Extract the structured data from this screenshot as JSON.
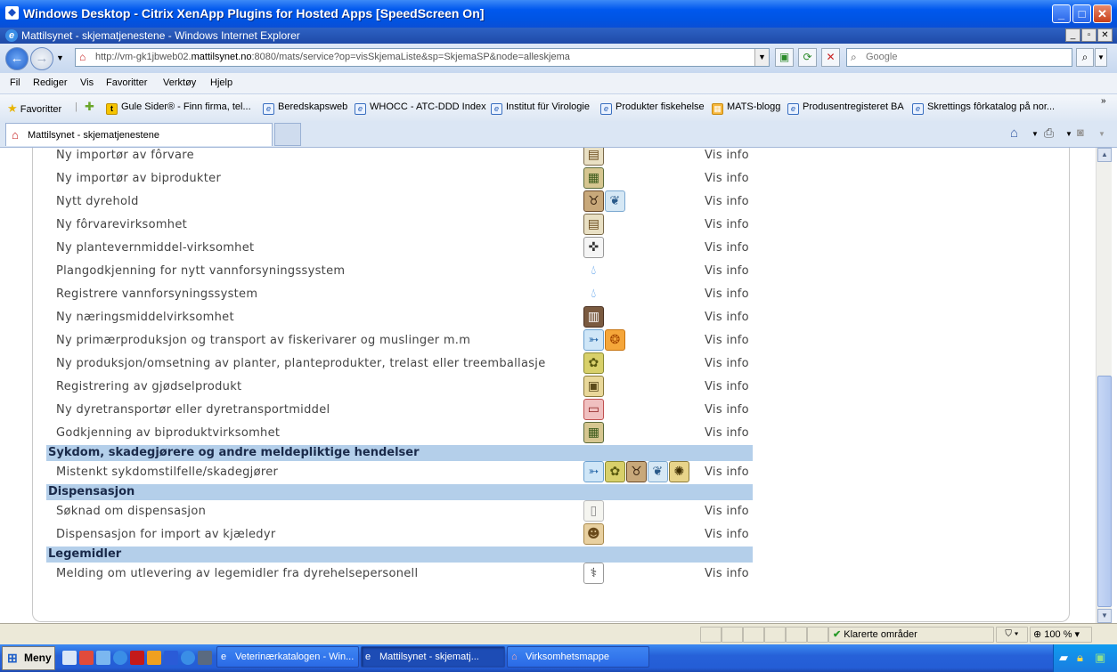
{
  "outer_window": {
    "title": "Windows Desktop - Citrix XenApp Plugins for Hosted Apps [SpeedScreen On]"
  },
  "ie_window": {
    "title": "Mattilsynet - skjematjenestene - Windows Internet Explorer"
  },
  "address": {
    "url_prefix": "http://vm-gk1jbweb02.",
    "url_host": "mattilsynet.no",
    "url_rest": ":8080/mats/service?op=visSkjemaListe&sp=SkjemaSP&node=alleskjema"
  },
  "search": {
    "placeholder": "Google"
  },
  "menu": [
    "Fil",
    "Rediger",
    "Vis",
    "Favoritter",
    "Verktøy",
    "Hjelp"
  ],
  "favorites": {
    "label": "Favoritter",
    "items": [
      "Gule Sider® - Finn firma, tel...",
      "Beredskapsweb",
      "WHOCC - ATC-DDD Index",
      "Institut für Virologie",
      "Produkter fiskehelse",
      "MATS-blogg",
      "Produsentregisteret BA",
      "Skrettings fôrkatalog på nor..."
    ]
  },
  "tabs": {
    "active": "Mattilsynet - skjematjenestene"
  },
  "content": {
    "info_label": "Vis info",
    "rows_a": [
      {
        "name": "Ny importør av fôrvare",
        "icons": [
          "feed-icon"
        ]
      },
      {
        "name": "Ny importør av biprodukter",
        "icons": [
          "byproduct-icon"
        ]
      },
      {
        "name": "Nytt dyrehold",
        "icons": [
          "cow-icon",
          "bird-icon"
        ]
      },
      {
        "name": "Ny fôrvarevirksomhet",
        "icons": [
          "feed-icon"
        ]
      },
      {
        "name": "Ny plantevernmiddel-virksomhet",
        "icons": [
          "sprayer-icon"
        ]
      },
      {
        "name": "Plangodkjenning for nytt vannforsyningssystem",
        "icons": [
          "water-drop-icon"
        ]
      },
      {
        "name": "Registrere vannforsyningssystem",
        "icons": [
          "water-drop-icon"
        ]
      },
      {
        "name": "Ny næringsmiddelvirksomhet",
        "icons": [
          "food-can-icon"
        ]
      },
      {
        "name": "Ny primærproduksjon og transport av fiskerivarer og muslinger m.m",
        "icons": [
          "fish-icon",
          "shell-icon"
        ]
      },
      {
        "name": "Ny produksjon/omsetning av planter, planteprodukter, trelast eller treemballasje",
        "icons": [
          "plant-icon"
        ]
      },
      {
        "name": "Registrering av gjødselprodukt",
        "icons": [
          "fertilizer-icon"
        ]
      },
      {
        "name": "Ny dyretransportør eller dyretransportmiddel",
        "icons": [
          "truck-icon"
        ]
      },
      {
        "name": "Godkjenning av biproduktvirksomhet",
        "icons": [
          "byproduct-icon"
        ]
      }
    ],
    "sections": [
      {
        "title": "Sykdom, skadegjørere og andre meldepliktige hendelser",
        "rows": [
          {
            "name": "Mistenkt sykdomstilfelle/skadegjører",
            "icons": [
              "fish-icon",
              "plant-icon",
              "cow-icon",
              "bird-icon",
              "bee-icon"
            ]
          }
        ]
      },
      {
        "title": "Dispensasjon",
        "rows": [
          {
            "name": "Søknad om dispensasjon",
            "icons": [
              "document-icon"
            ]
          },
          {
            "name": "Dispensasjon for import av kjæledyr",
            "icons": [
              "dog-icon"
            ]
          }
        ]
      },
      {
        "title": "Legemidler",
        "rows": [
          {
            "name": "Melding om utlevering av legemidler fra dyrehelsepersonell",
            "icons": [
              "syringe-icon"
            ]
          }
        ]
      }
    ]
  },
  "status": {
    "zone": "Klarerte områder",
    "zoom": "100 %"
  },
  "taskbar": {
    "start": "Meny",
    "tasks": [
      "Veterinærkatalogen - Win...",
      "Mattilsynet - skjematj...",
      "Virksomhetsmappe"
    ]
  },
  "colors": {
    "section_bg": "#b4cfea",
    "title_blue": "#0054e3"
  }
}
